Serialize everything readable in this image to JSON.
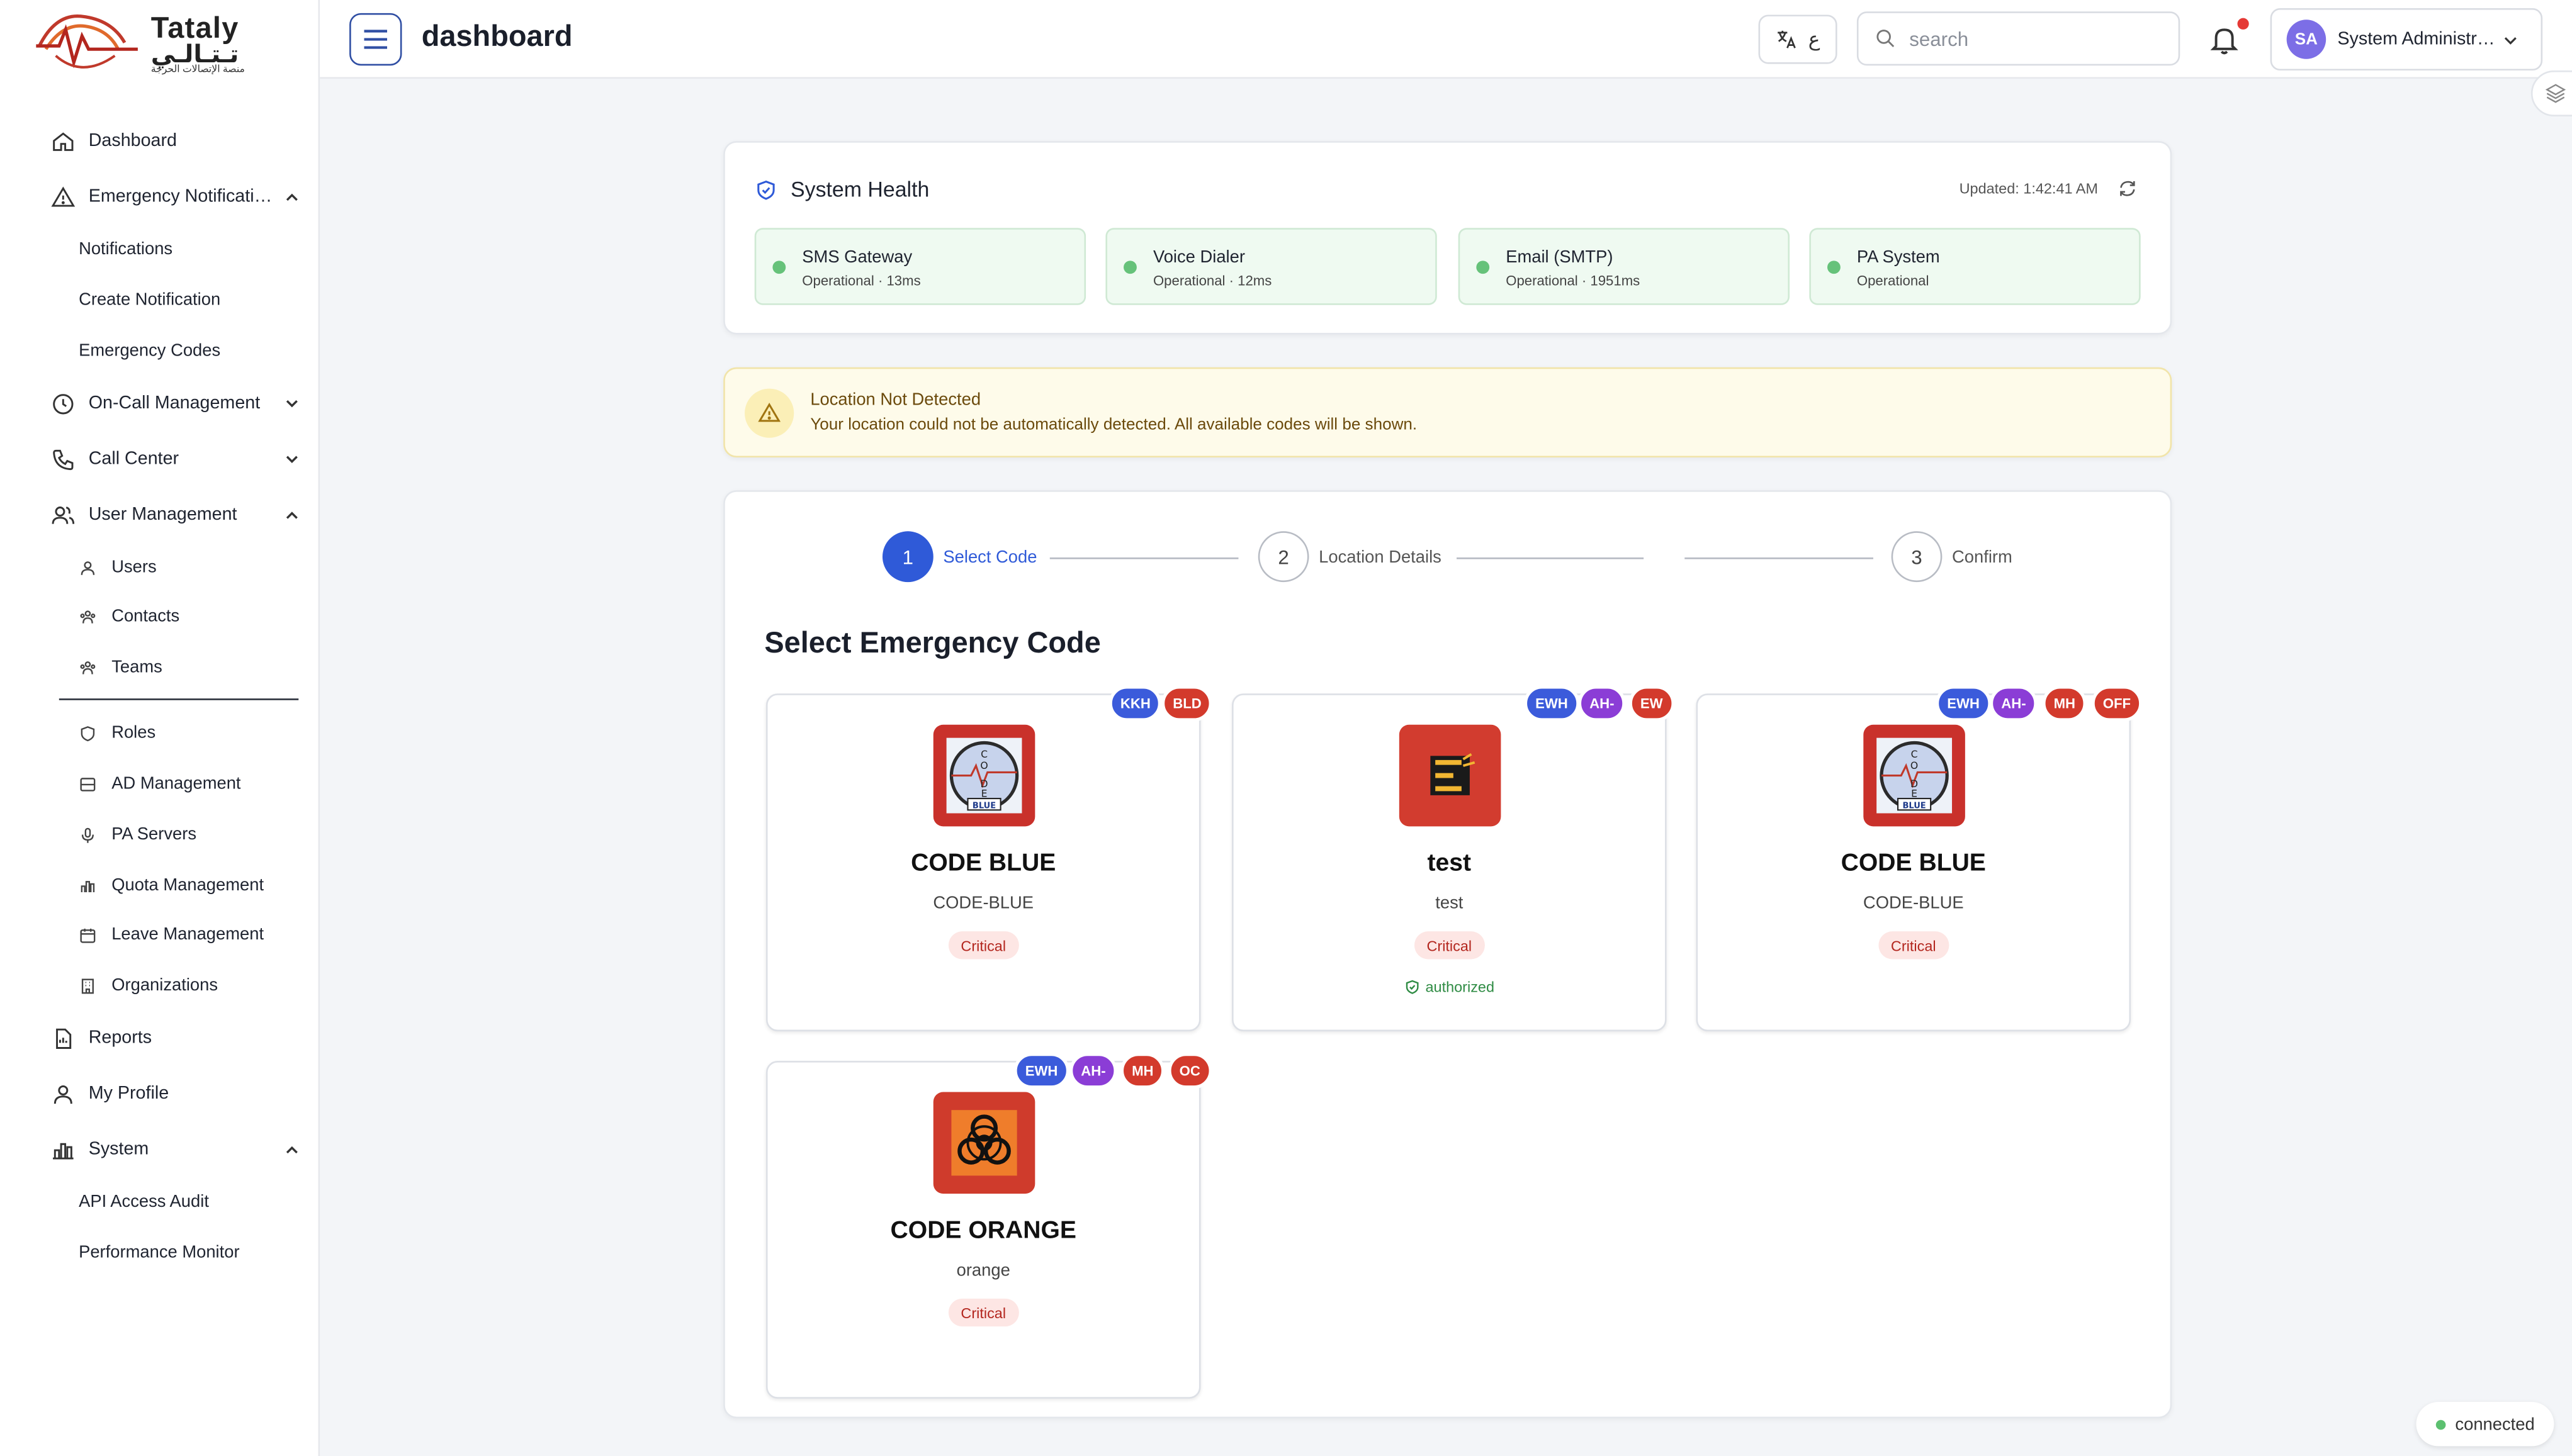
{
  "brand": {
    "name_latin": "Tataly",
    "name_arabic": "تـتـالـي",
    "tagline": "منصة الإتصالات الحرجة"
  },
  "header": {
    "title": "dashboard",
    "lang_label": "ع",
    "search_placeholder": "search",
    "user_initials": "SA",
    "user_name": "System Administrator"
  },
  "sidebar": {
    "items": [
      {
        "label": "Dashboard",
        "icon": "home-icon"
      },
      {
        "label": "Emergency Notifications",
        "icon": "alert-triangle-icon",
        "expanded": true
      },
      {
        "label": "Notifications"
      },
      {
        "label": "Create Notification"
      },
      {
        "label": "Emergency Codes"
      },
      {
        "label": "On-Call Management",
        "icon": "clock-icon",
        "expanded": false
      },
      {
        "label": "Call Center",
        "icon": "phone-icon",
        "expanded": false
      },
      {
        "label": "User Management",
        "icon": "users-icon",
        "expanded": true
      },
      {
        "label": "Users",
        "icon": "user-icon"
      },
      {
        "label": "Contacts",
        "icon": "contacts-icon"
      },
      {
        "label": "Teams",
        "icon": "teams-icon"
      },
      {
        "label": "Roles",
        "icon": "shield-icon"
      },
      {
        "label": "AD Management",
        "icon": "server-icon"
      },
      {
        "label": "PA Servers",
        "icon": "mic-icon"
      },
      {
        "label": "Quota Management",
        "icon": "bar-chart-icon"
      },
      {
        "label": "Leave Management",
        "icon": "calendar-icon"
      },
      {
        "label": "Organizations",
        "icon": "building-icon"
      },
      {
        "label": "Reports",
        "icon": "report-icon"
      },
      {
        "label": "My Profile",
        "icon": "profile-icon"
      },
      {
        "label": "System",
        "icon": "system-chart-icon",
        "expanded": true
      },
      {
        "label": "API Access Audit"
      },
      {
        "label": "Performance Monitor"
      }
    ]
  },
  "health": {
    "title": "System Health",
    "updated": "Updated: 1:42:41 AM",
    "services": [
      {
        "name": "SMS Gateway",
        "status": "Operational · 13ms"
      },
      {
        "name": "Voice Dialer",
        "status": "Operational · 12ms"
      },
      {
        "name": "Email (SMTP)",
        "status": "Operational · 1951ms"
      },
      {
        "name": "PA System",
        "status": "Operational"
      }
    ]
  },
  "warning": {
    "title": "Location Not Detected",
    "message": "Your location could not be automatically detected. All available codes will be shown."
  },
  "stepper": {
    "steps": [
      {
        "num": "1",
        "label": "Select Code"
      },
      {
        "num": "2",
        "label": "Location Details"
      },
      {
        "num": "3",
        "label": "Confirm"
      }
    ]
  },
  "codes": {
    "section_title": "Select Emergency Code",
    "cards": [
      {
        "name": "CODE BLUE",
        "id": "CODE-BLUE",
        "severity": "Critical",
        "tags": [
          "KKH",
          "BLD"
        ]
      },
      {
        "name": "test",
        "id": "test",
        "severity": "Critical",
        "authorized": "authorized",
        "tags": [
          "EWH",
          "AH-",
          "EW"
        ]
      },
      {
        "name": "CODE BLUE",
        "id": "CODE-BLUE",
        "severity": "Critical",
        "tags": [
          "EWH",
          "AH-",
          "MH",
          "OFF"
        ]
      },
      {
        "name": "CODE ORANGE",
        "id": "orange",
        "severity": "Critical",
        "tags": [
          "EWH",
          "AH-",
          "MH",
          "OC"
        ]
      }
    ]
  },
  "status": {
    "connection": "connected"
  },
  "colors": {
    "primary": "#2f5ad8",
    "critical_bg": "#fde6e4",
    "operational": "#66c27a",
    "warning_bg": "#fefbea"
  }
}
